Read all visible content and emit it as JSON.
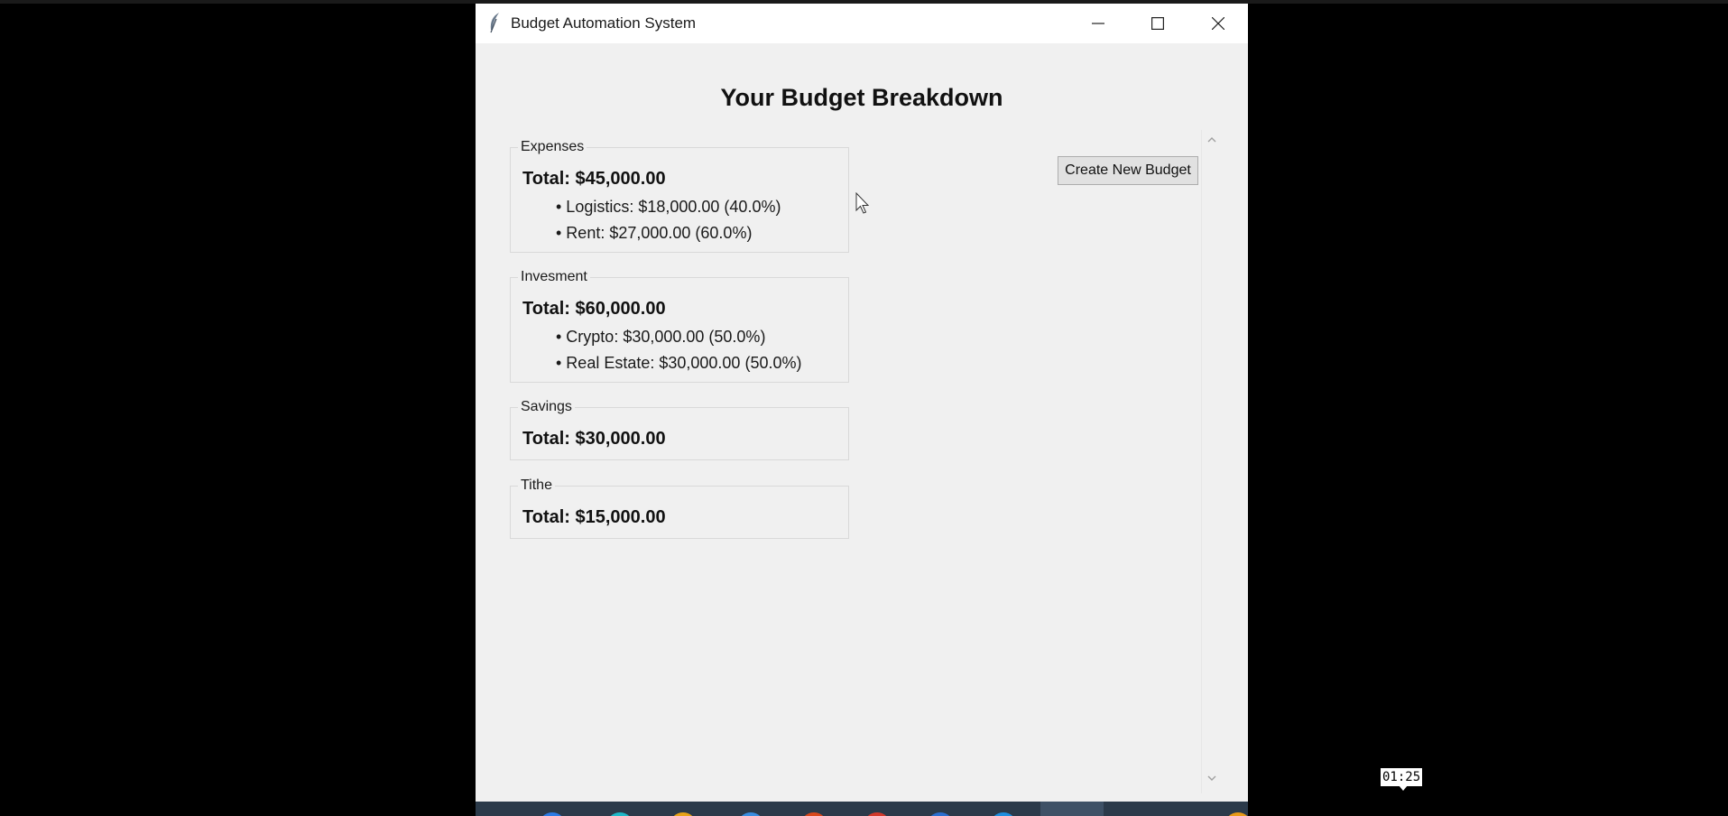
{
  "window": {
    "title": "Budget Automation System",
    "app_icon": "feather-icon",
    "controls": {
      "minimize": "minimize-icon",
      "maximize": "maximize-icon",
      "close": "close-icon"
    }
  },
  "main": {
    "heading": "Your Budget Breakdown",
    "create_button_label": "Create New Budget",
    "categories": [
      {
        "name": "Expenses",
        "total": "Total: $45,000.00",
        "items": [
          "• Logistics: $18,000.00 (40.0%)",
          "• Rent: $27,000.00 (60.0%)"
        ]
      },
      {
        "name": "Invesment",
        "total": "Total: $60,000.00",
        "items": [
          "• Crypto: $30,000.00 (50.0%)",
          "• Real Estate: $30,000.00 (50.0%)"
        ]
      },
      {
        "name": "Savings",
        "total": "Total: $30,000.00",
        "items": []
      },
      {
        "name": "Tithe",
        "total": "Total: $15,000.00",
        "items": []
      }
    ]
  },
  "overlay": {
    "timestamp": "01:25"
  },
  "colors": {
    "window_bg": "#f0f0f0",
    "titlebar_bg": "#ffffff",
    "screen_bg": "#000000",
    "button_bg": "#e1e1e1",
    "group_border": "#d9d9d9"
  }
}
